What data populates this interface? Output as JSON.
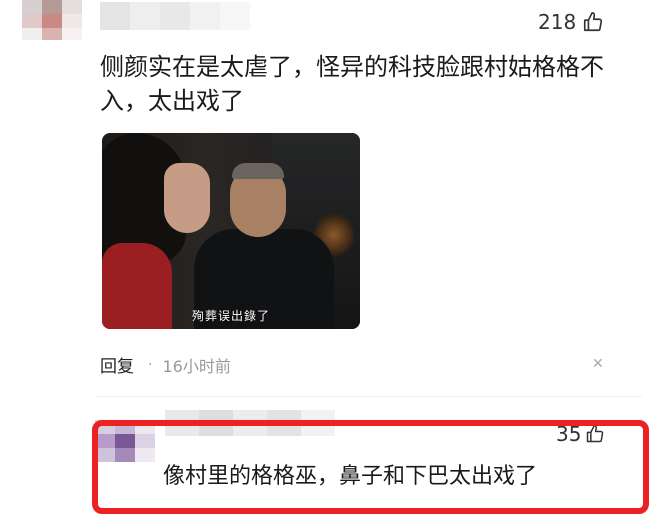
{
  "comments": [
    {
      "likes": "218",
      "text": "侧颜实在是太虐了，怪异的科技脸跟村姑格格不入，太出戏了",
      "media": {
        "subtitle": "殉葬误出錄了"
      },
      "reply_label": "回复",
      "separator": "·",
      "time": "16小时前",
      "more_glyph": "✕"
    },
    {
      "likes": "35",
      "text": "像村里的格格巫，鼻子和下巴太出戏了"
    }
  ],
  "colors": {
    "highlight_border": "#ec2222",
    "meta_gray": "#999999"
  },
  "icons": [
    "thumbs-up-icon",
    "close-icon"
  ]
}
